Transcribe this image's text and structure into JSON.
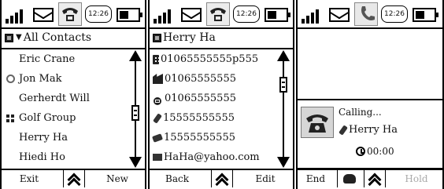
{
  "status_bar": {
    "time": "12:26"
  },
  "contacts_screen": {
    "title": "All Contacts",
    "contacts": [
      {
        "name": "Eric Crane",
        "icon": "none"
      },
      {
        "name": "Jon Mak",
        "icon": "person-icon"
      },
      {
        "name": "Gerherdt Will",
        "icon": "none"
      },
      {
        "name": "Golf Group",
        "icon": "group-icon"
      },
      {
        "name": "Herry Ha",
        "icon": "none"
      },
      {
        "name": "Hiedi Ho",
        "icon": "none"
      }
    ],
    "scroll_position": 0.55,
    "softkeys": {
      "left": "Exit",
      "right": "New"
    }
  },
  "detail_screen": {
    "title": "Herry Ha",
    "entries": [
      {
        "value": "01065555555p555",
        "icon": "building-icon"
      },
      {
        "value": "01065555555",
        "icon": "factory-icon"
      },
      {
        "value": "01065555555",
        "icon": "handset-icon"
      },
      {
        "value": "15555555555",
        "icon": "mobile-icon"
      },
      {
        "value": "15555555555",
        "icon": "mobile2-icon"
      },
      {
        "value": "HaHa@yahoo.com",
        "icon": "mail-icon"
      }
    ],
    "scroll_position": 0.2,
    "softkeys": {
      "left": "Back",
      "right": "Edit"
    }
  },
  "call_screen": {
    "status": "Calling...",
    "callee": "Herry Ha",
    "timer": "00:00",
    "softkeys": {
      "left": "End",
      "right": "Hold"
    },
    "hold_color": "#aaaaaa"
  }
}
